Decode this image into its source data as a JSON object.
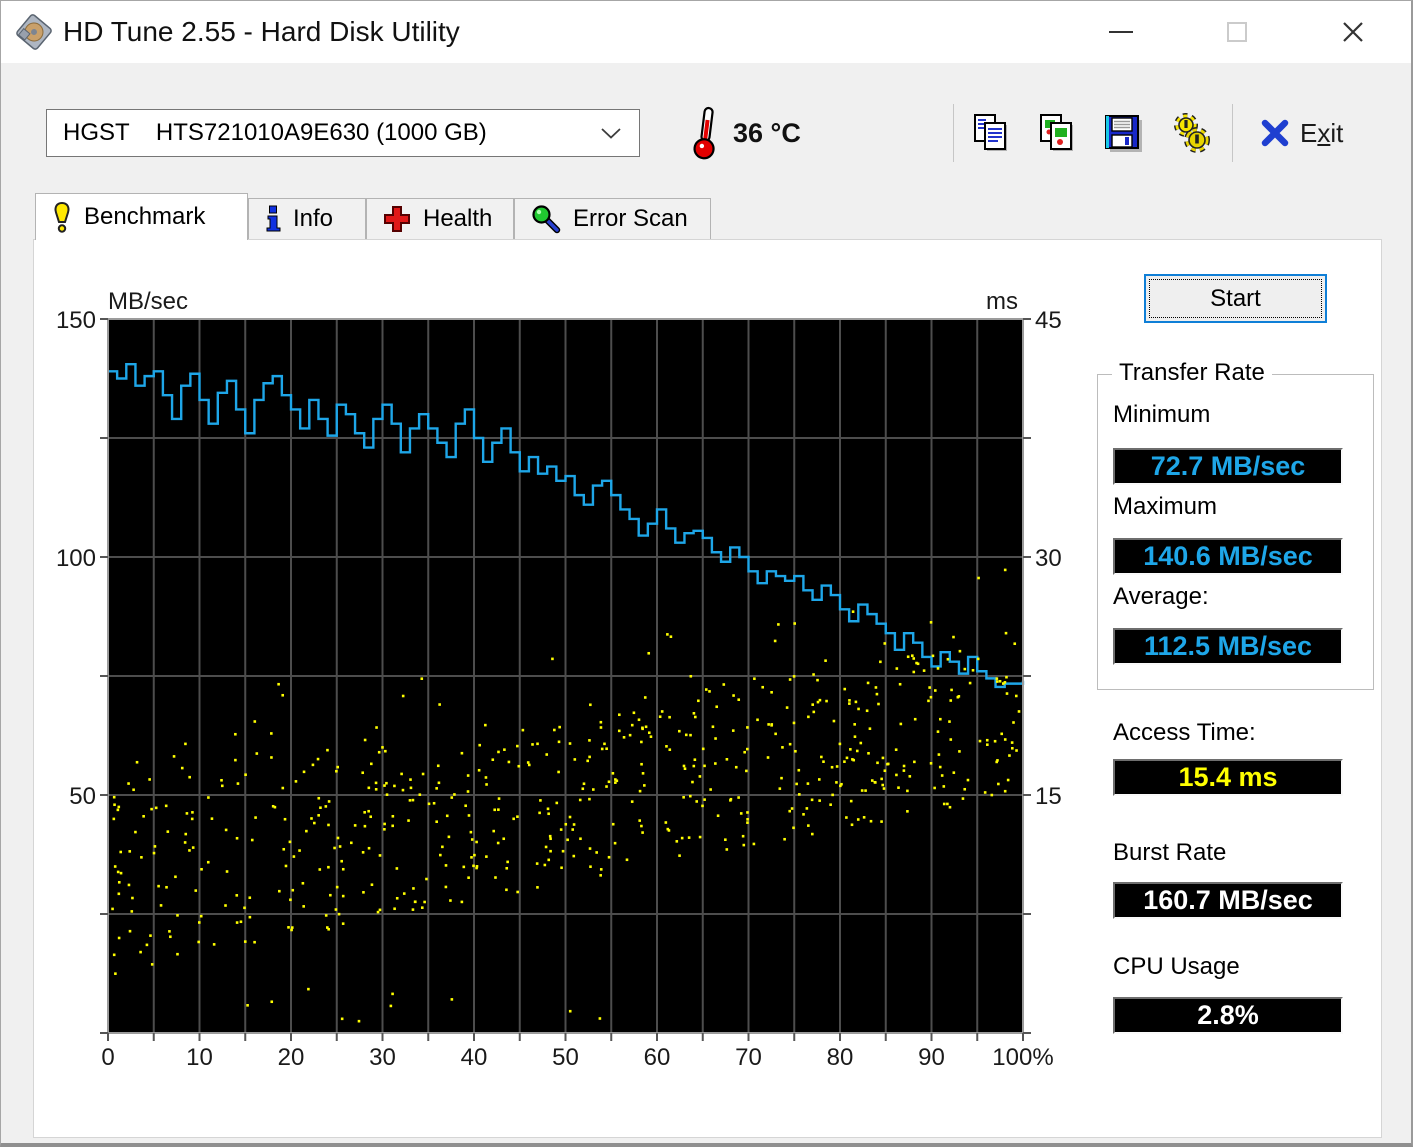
{
  "window": {
    "title": "HD Tune 2.55 - Hard Disk Utility",
    "controls": {
      "minimize": "minimize",
      "maximize": "maximize",
      "close": "close"
    }
  },
  "toolbar": {
    "drive_selector": {
      "value": "HGST    HTS721010A9E630 (1000 GB)"
    },
    "temperature": "36 °C",
    "icons": [
      "copy-text-icon",
      "copy-image-icon",
      "save-icon",
      "options-icon"
    ],
    "exit": {
      "pre": "E",
      "accel": "x",
      "post": "it"
    }
  },
  "tabs": [
    {
      "label": "Benchmark",
      "icon": "benchmark-bulb-icon",
      "active": true
    },
    {
      "label": "Info",
      "icon": "info-icon",
      "active": false
    },
    {
      "label": "Health",
      "icon": "health-cross-icon",
      "active": false
    },
    {
      "label": "Error Scan",
      "icon": "error-scan-magnifier-icon",
      "active": false
    }
  ],
  "chart_data": {
    "type": "line+scatter",
    "title": "",
    "x_axis": {
      "range": [
        0,
        100
      ],
      "grid_step": 5,
      "label_step": 10,
      "tick_labels": [
        "0",
        "10",
        "20",
        "30",
        "40",
        "50",
        "60",
        "70",
        "80",
        "90",
        "100%"
      ]
    },
    "left_axis": {
      "label": "MB/sec",
      "range": [
        0,
        150
      ],
      "grid_step": 25,
      "ticks": [
        150,
        100,
        50
      ]
    },
    "right_axis": {
      "label": "ms",
      "range": [
        0,
        45
      ],
      "grid_step": 7.5,
      "ticks": [
        45,
        30,
        15
      ]
    },
    "plot_bg": "#000000",
    "grid_color": "#4d4d4d",
    "border_color": "#9b9b9b",
    "series": [
      {
        "name": "transfer_rate",
        "type": "line",
        "axis": "left",
        "color": "#1ea6e8",
        "x_step": 1,
        "values": [
          139,
          137.5,
          140.5,
          136,
          138,
          139,
          134,
          129,
          136,
          138.5,
          133,
          128,
          134.5,
          137,
          131,
          126,
          133,
          136.5,
          138,
          134,
          131,
          127,
          133,
          129,
          125.5,
          132,
          130,
          126,
          123,
          129,
          132,
          128,
          122,
          127,
          130,
          127,
          124,
          121,
          128,
          131,
          125,
          120,
          124,
          127,
          122,
          118,
          121,
          117.5,
          119,
          116,
          117,
          113,
          111,
          115,
          116,
          113,
          110,
          108,
          104.5,
          107,
          110,
          106,
          103,
          105,
          105.5,
          104,
          101,
          99,
          102,
          100,
          97,
          94.5,
          97,
          96,
          95,
          96,
          93,
          91,
          94,
          92,
          89,
          86.5,
          90,
          88,
          86,
          84,
          80.5,
          84,
          82,
          79,
          77,
          80,
          78,
          75.5,
          79,
          76,
          74.5,
          72.7,
          73.4,
          73.4,
          74
        ]
      },
      {
        "name": "access_time",
        "type": "scatter",
        "axis": "right",
        "color": "#ffff00",
        "point_size": 2.6,
        "generator": {
          "seed": 987654321,
          "count": 600,
          "band_low": [
            3.5,
            0.115
          ],
          "band_high": [
            16.0,
            0.09
          ],
          "outlier_rate": 0.05,
          "outlier_spread": 4.5,
          "floor_outlier_rate": 0.012,
          "floor_max_x": 55
        }
      }
    ]
  },
  "panel": {
    "start_label": "Start",
    "transfer_rate": {
      "title": "Transfer Rate",
      "rows": [
        {
          "label": "Minimum",
          "value": "72.7 MB/sec",
          "color": "#1ea6e8"
        },
        {
          "label": "Maximum",
          "value": "140.6 MB/sec",
          "color": "#1ea6e8"
        },
        {
          "label": "Average:",
          "value": "112.5 MB/sec",
          "color": "#1ea6e8"
        }
      ]
    },
    "access_time": {
      "label": "Access Time:",
      "value": "15.4 ms",
      "color": "#ffff00"
    },
    "burst_rate": {
      "label": "Burst Rate",
      "value": "160.7 MB/sec",
      "color": "#ffffff"
    },
    "cpu_usage": {
      "label": "CPU Usage",
      "value": "2.8%",
      "color": "#ffffff"
    }
  }
}
